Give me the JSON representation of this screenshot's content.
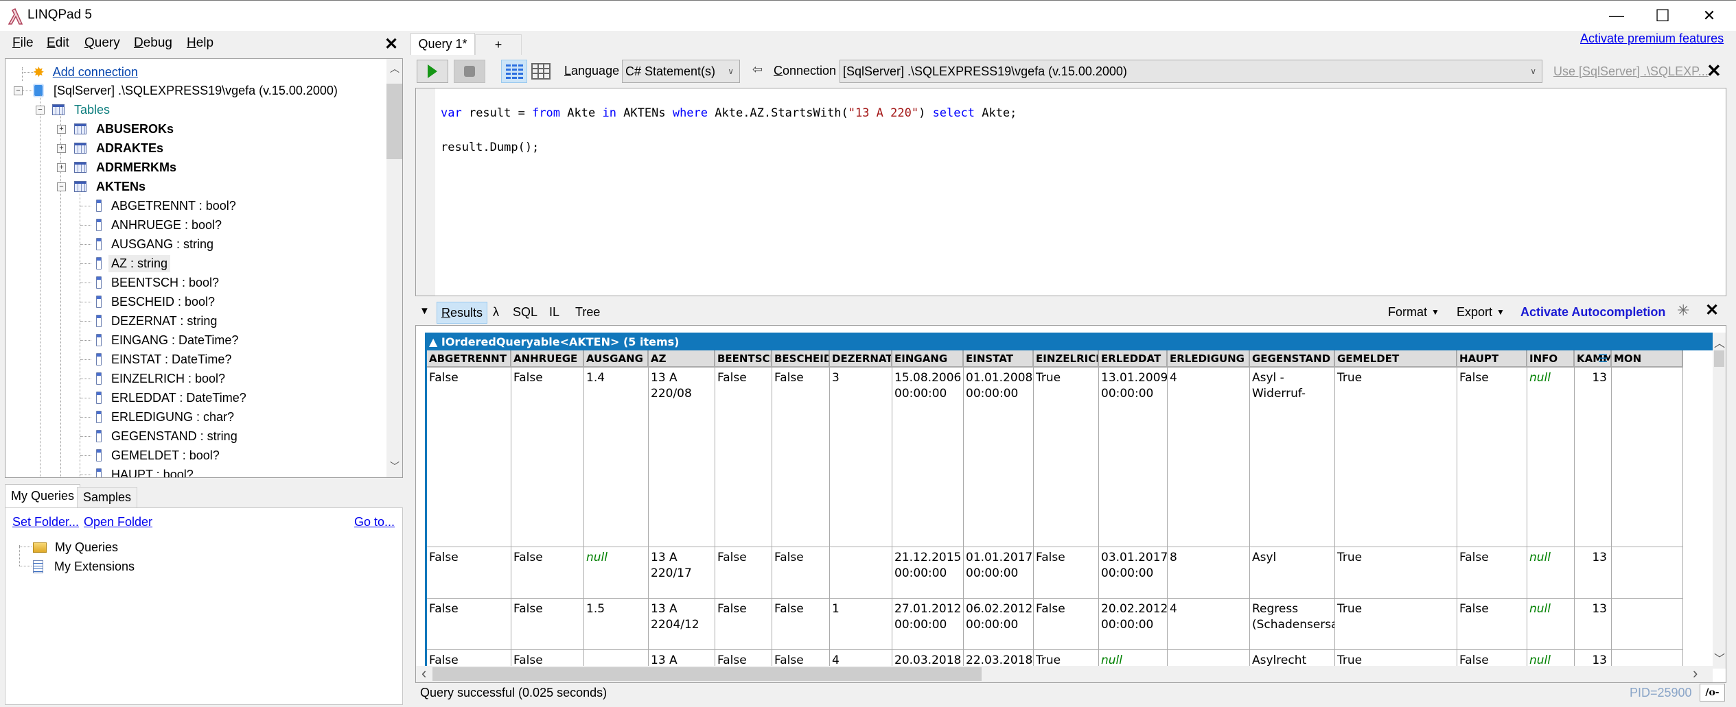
{
  "window": {
    "title": "LINQPad 5",
    "minimize_glyph": "—",
    "maximize_glyph": "☐",
    "close_glyph": "✕"
  },
  "menu": {
    "items": [
      {
        "label": "File",
        "accel": "F",
        "rest": "ile"
      },
      {
        "label": "Edit",
        "accel": "E",
        "rest": "dit"
      },
      {
        "label": "Query",
        "accel": "Q",
        "rest": "uery"
      },
      {
        "label": "Debug",
        "accel": "D",
        "rest": "ebug"
      },
      {
        "label": "Help",
        "accel": "H",
        "rest": "elp"
      }
    ],
    "close_glyph": "✕"
  },
  "tree": {
    "add_connection": "Add connection",
    "connection": "[SqlServer] .\\SQLEXPRESS19\\vgefa (v.15.00.2000)",
    "tables_label": "Tables",
    "tables": [
      "ABUSEROKs",
      "ADRAKTEs",
      "ADRMERKMs",
      "AKTENs"
    ],
    "columns": [
      "ABGETRENNT : bool?",
      "ANHRUEGE : bool?",
      "AUSGANG : string",
      "AZ : string",
      "BEENTSCH : bool?",
      "BESCHEID : bool?",
      "DEZERNAT : string",
      "EINGANG : DateTime?",
      "EINSTAT : DateTime?",
      "EINZELRICH : bool?",
      "ERLEDDAT : DateTime?",
      "ERLEDIGUNG : char?",
      "GEGENSTAND : string",
      "GEMELDET : bool?",
      "HAUPT : bool?"
    ],
    "selected_column": "AZ : string"
  },
  "queries_panel": {
    "tabs": [
      "My Queries",
      "Samples"
    ],
    "active_tab": "My Queries",
    "set_folder": "Set Folder...",
    "open_folder": "Open Folder",
    "go_to": "Go to...",
    "items": [
      "My Queries",
      "My Extensions"
    ]
  },
  "header": {
    "premium_link": "Activate premium features"
  },
  "query_tabs": [
    {
      "label": "Query 1*",
      "active": true
    },
    {
      "label": "+",
      "active": false
    }
  ],
  "toolbar": {
    "language_label": "Language",
    "language_value": "C# Statement(s)",
    "connection_label": "Connection",
    "connection_value": "[SqlServer] .\\SQLEXPRESS19\\vgefa (v.15.00.2000)",
    "use_link": "Use [SqlServer] .\\SQLEXP...",
    "close_glyph": "✕"
  },
  "editor": {
    "line1": {
      "t1": "var",
      "t2": " result = ",
      "t3": "from",
      "t4": " Akte ",
      "t5": "in",
      "t6": " AKTENs ",
      "t7": "where",
      "t8": " Akte.AZ.StartsWith(",
      "t9": "\"13 A 220\"",
      "t10": ") ",
      "t11": "select",
      "t12": " Akte;"
    },
    "line2": "result.Dump();"
  },
  "results_bar": {
    "tabs": [
      "Results",
      "λ",
      "SQL",
      "IL",
      "Tree"
    ],
    "active_tab": "Results",
    "format": "Format",
    "export": "Export",
    "autocompletion": "Activate Autocompletion",
    "close_glyph": "✕"
  },
  "grid": {
    "title": "▲ IOrderedQueryable<AKTEN> (5 items)",
    "columns": [
      "ABGETRENNT",
      "ANHRUEGE",
      "AUSGANG",
      "AZ",
      "BEENTSCH",
      "BESCHEID",
      "DEZERNAT",
      "EINGANG",
      "EINSTAT",
      "EINZELRICH",
      "ERLEDDAT",
      "ERLEDIGUNG",
      "GEGENSTAND",
      "GEMELDET",
      "HAUPT",
      "INFO",
      "KAMMER",
      "MON"
    ],
    "rows": [
      [
        "False",
        "False",
        "1.4",
        "13 A\n220/08",
        "False",
        "False",
        "3",
        "15.08.2006\n00:00:00",
        "01.01.2008\n00:00:00",
        "True",
        "13.01.2009\n00:00:00",
        "4",
        "Asyl -Widerruf-",
        "True",
        "False",
        "null",
        "13",
        ""
      ],
      [
        "False",
        "False",
        "null",
        "13 A\n220/17",
        "False",
        "False",
        "",
        "21.12.2015\n00:00:00",
        "01.01.2017\n00:00:00",
        "False",
        "03.01.2017\n00:00:00",
        "8",
        "Asyl",
        "True",
        "False",
        "null",
        "13",
        ""
      ],
      [
        "False",
        "False",
        "1.5",
        "13 A\n2204/12",
        "False",
        "False",
        "1",
        "27.01.2012\n00:00:00",
        "06.02.2012\n00:00:00",
        "False",
        "20.02.2012\n00:00:00",
        "4",
        "Regress\n(Schadensersatz)",
        "True",
        "False",
        "null",
        "13",
        ""
      ],
      [
        "False",
        "False",
        "",
        "13 A",
        "False",
        "False",
        "4",
        "20.03.2018",
        "22.03.2018",
        "True",
        "null",
        "",
        "Asylrecht Türkei",
        "True",
        "False",
        "null",
        "13",
        ""
      ]
    ]
  },
  "status": {
    "message": "Query successful  (0.025 seconds)",
    "pid": "PID=25900",
    "pid_button": "/o-"
  }
}
